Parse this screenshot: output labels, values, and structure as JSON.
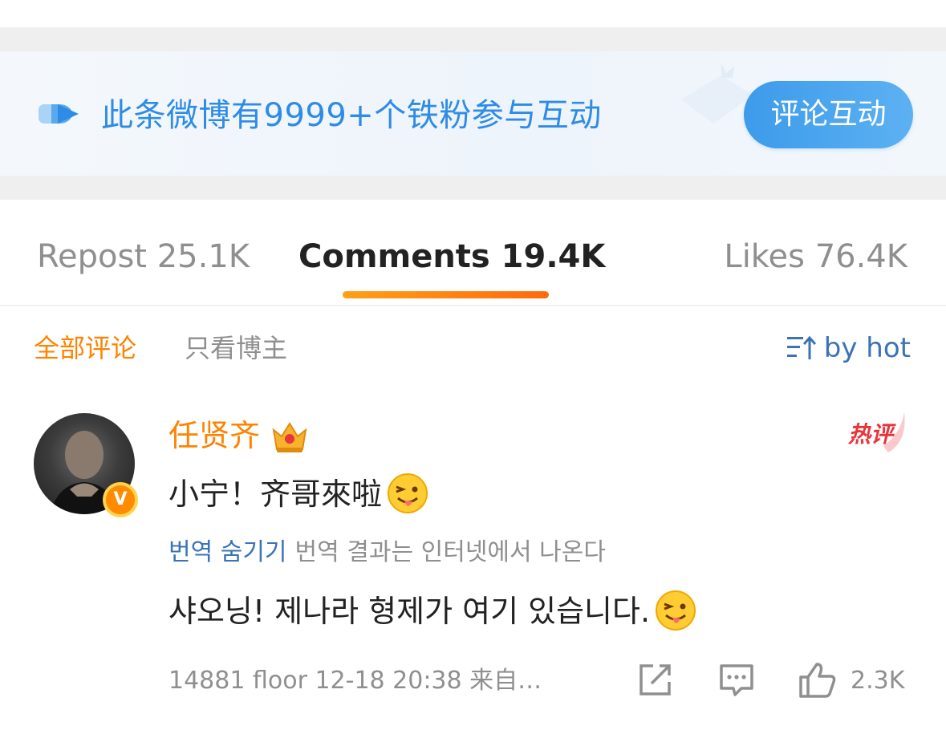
{
  "fan_banner": {
    "text": "此条微博有9999+个铁粉参与互动",
    "button_label": "评论互动",
    "icon": "fan-play-icon"
  },
  "tabs": [
    {
      "label": "Repost 25.1K",
      "active": false
    },
    {
      "label": "Comments 19.4K",
      "active": true
    },
    {
      "label": "Likes 76.4K",
      "active": false
    }
  ],
  "filters": {
    "all_label": "全部评论",
    "blogger_only_label": "只看博主",
    "sort_label": "by hot",
    "sort_icon": "sort-icon"
  },
  "comment": {
    "username": "任贤齐",
    "hot_badge": "热评",
    "text": "小宁！齐哥來啦",
    "translate_link": "번역 숨기기",
    "translate_note": "번역 결과는 인터넷에서 나온다",
    "translated_text": "샤오닝! 제나라 형제가 여기 있습니다.",
    "meta": "14881 floor 12-18 20:38 来自…",
    "like_count": "2.3K",
    "verify_badge": "V"
  },
  "colors": {
    "accent_orange": "#ff8200",
    "link_blue": "#3a73b7",
    "banner_blue": "#2f8ce6",
    "hot_red": "#e8343a"
  }
}
